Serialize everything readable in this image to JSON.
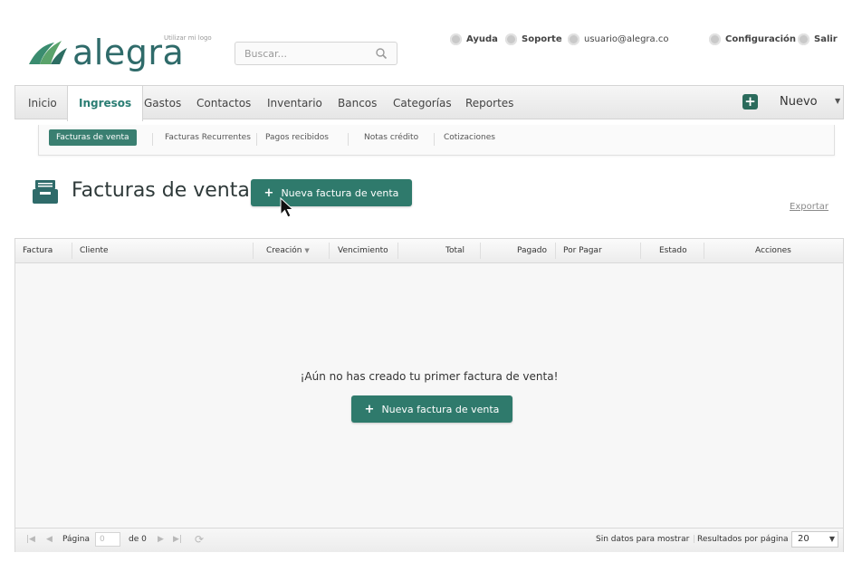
{
  "header": {
    "logo_text": "alegra",
    "logo_tagline": "Utilizar mi logo",
    "search_placeholder": "Buscar...",
    "links": {
      "ayuda": "Ayuda",
      "soporte": "Soporte",
      "user": "usuario@alegra.co",
      "configuracion": "Configuración",
      "salir": "Salir"
    }
  },
  "nav": {
    "items": [
      "Inicio",
      "Ingresos",
      "Gastos",
      "Contactos",
      "Inventario",
      "Bancos",
      "Categorías",
      "Reportes"
    ],
    "active": "Ingresos",
    "nuevo_label": "Nuevo"
  },
  "subnav": {
    "items": [
      "Facturas de venta",
      "Facturas Recurrentes",
      "Pagos recibidos",
      "Notas crédito",
      "Cotizaciones"
    ],
    "active": "Facturas de venta"
  },
  "page": {
    "title": "Facturas de venta",
    "new_button": "Nueva factura de venta",
    "export_label": "Exportar"
  },
  "table": {
    "columns": [
      "Factura",
      "Cliente",
      "Creación",
      "Vencimiento",
      "Total",
      "Pagado",
      "Por Pagar",
      "Estado",
      "Acciones"
    ],
    "empty_message": "¡Aún no has creado tu primer factura de venta!",
    "empty_button": "Nueva factura de venta"
  },
  "pager": {
    "page_label": "Página",
    "page_value": "0",
    "of_label": "de 0",
    "no_data": "Sin datos para mostrar",
    "per_page_label": "Resultados por página",
    "per_page_value": "20"
  },
  "colors": {
    "accent": "#2f7a6c",
    "logo": "#2f6b6a"
  }
}
